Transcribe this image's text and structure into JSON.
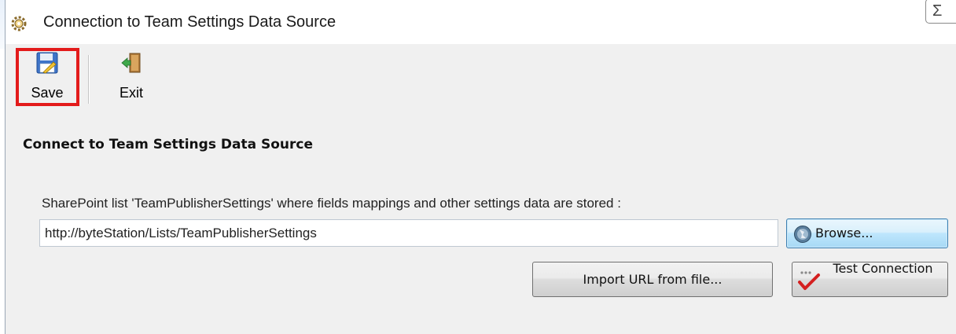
{
  "window": {
    "title": "Connection to Team Settings Data Source",
    "close_glyph": "Σ",
    "title_icon": "settings-gear-icon"
  },
  "toolbar": {
    "save_label": "Save",
    "save_icon": "floppy-disk-icon",
    "exit_label": "Exit",
    "exit_icon": "exit-door-icon",
    "highlight_color": "#e31b1b"
  },
  "main": {
    "section_title": "Connect to Team Settings Data Source",
    "field_label": "SharePoint list 'TeamPublisherSettings' where fields mappings and other settings data are stored :",
    "url_value": "http://byteStation/Lists/TeamPublisherSettings",
    "browse_label": "Browse...",
    "browse_icon": "globe-icon",
    "import_label": "Import URL from file...",
    "test_label": "Test Connection",
    "test_icon": "checkmark-icon"
  }
}
